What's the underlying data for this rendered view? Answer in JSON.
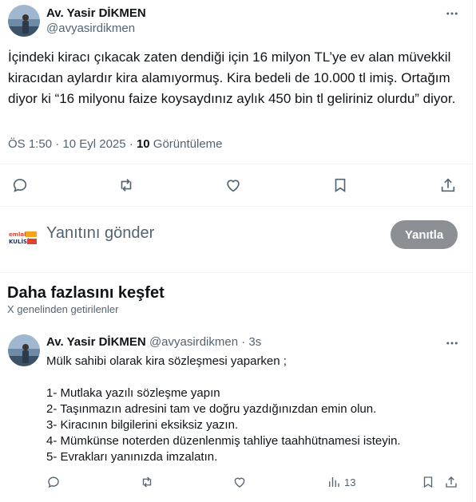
{
  "tweet": {
    "author_name": "Av. Yasir DİKMEN",
    "author_handle": "@avyasirdikmen",
    "text": "İçindeki kiracı çıkacak zaten dendiği için 16 milyon TL’ye ev alan müvekkil kiracıdan aylardır kira alamıyormuş. Kira bedeli de 10.000 tl imiş. Ortağım diyor ki “16 milyonu faize koysaydınız aylık 450 bin tl geliriniz olurdu” diyor.",
    "time": "ÖS 1:50 · 10 Eyl 2025",
    "views_count": "10",
    "views_label": "Görüntüleme",
    "icons": {
      "more": "more-icon",
      "reply": "reply-icon",
      "retweet": "retweet-icon",
      "like": "like-icon",
      "bookmark": "bookmark-icon",
      "share": "share-icon"
    }
  },
  "reply_box": {
    "logo_text_top": "emlak",
    "logo_text_bottom": "KULİSİ",
    "placeholder": "Yanıtını gönder",
    "button_label": "Yanıtla"
  },
  "discover": {
    "title": "Daha fazlasını keşfet",
    "subtitle": "X genelinden getirilenler"
  },
  "tweet2": {
    "author_name": "Av. Yasir DİKMEN",
    "author_handle": "@avyasirdikmen",
    "time": "3s",
    "lines": [
      "Mülk sahibi olarak kira sözleşmesi yaparken ;",
      "",
      "1- Mutlaka yazılı sözleşme yapın",
      "2- Taşınmazın adresini tam ve doğru yazdığınızdan emin olun.",
      "3- Kiracının bilgilerini eksiksiz yazın.",
      "4- Mümkünse noterden düzenlenmiş tahliye taahhütnamesi isteyin.",
      "5- Evrakları yanınızda imzalatın."
    ],
    "views": "13"
  },
  "colors": {
    "text": "#0f1419",
    "secondary": "#536471",
    "button": "#8c9094",
    "logo_red": "#e0442f",
    "logo_orange": "#f4a51c"
  }
}
